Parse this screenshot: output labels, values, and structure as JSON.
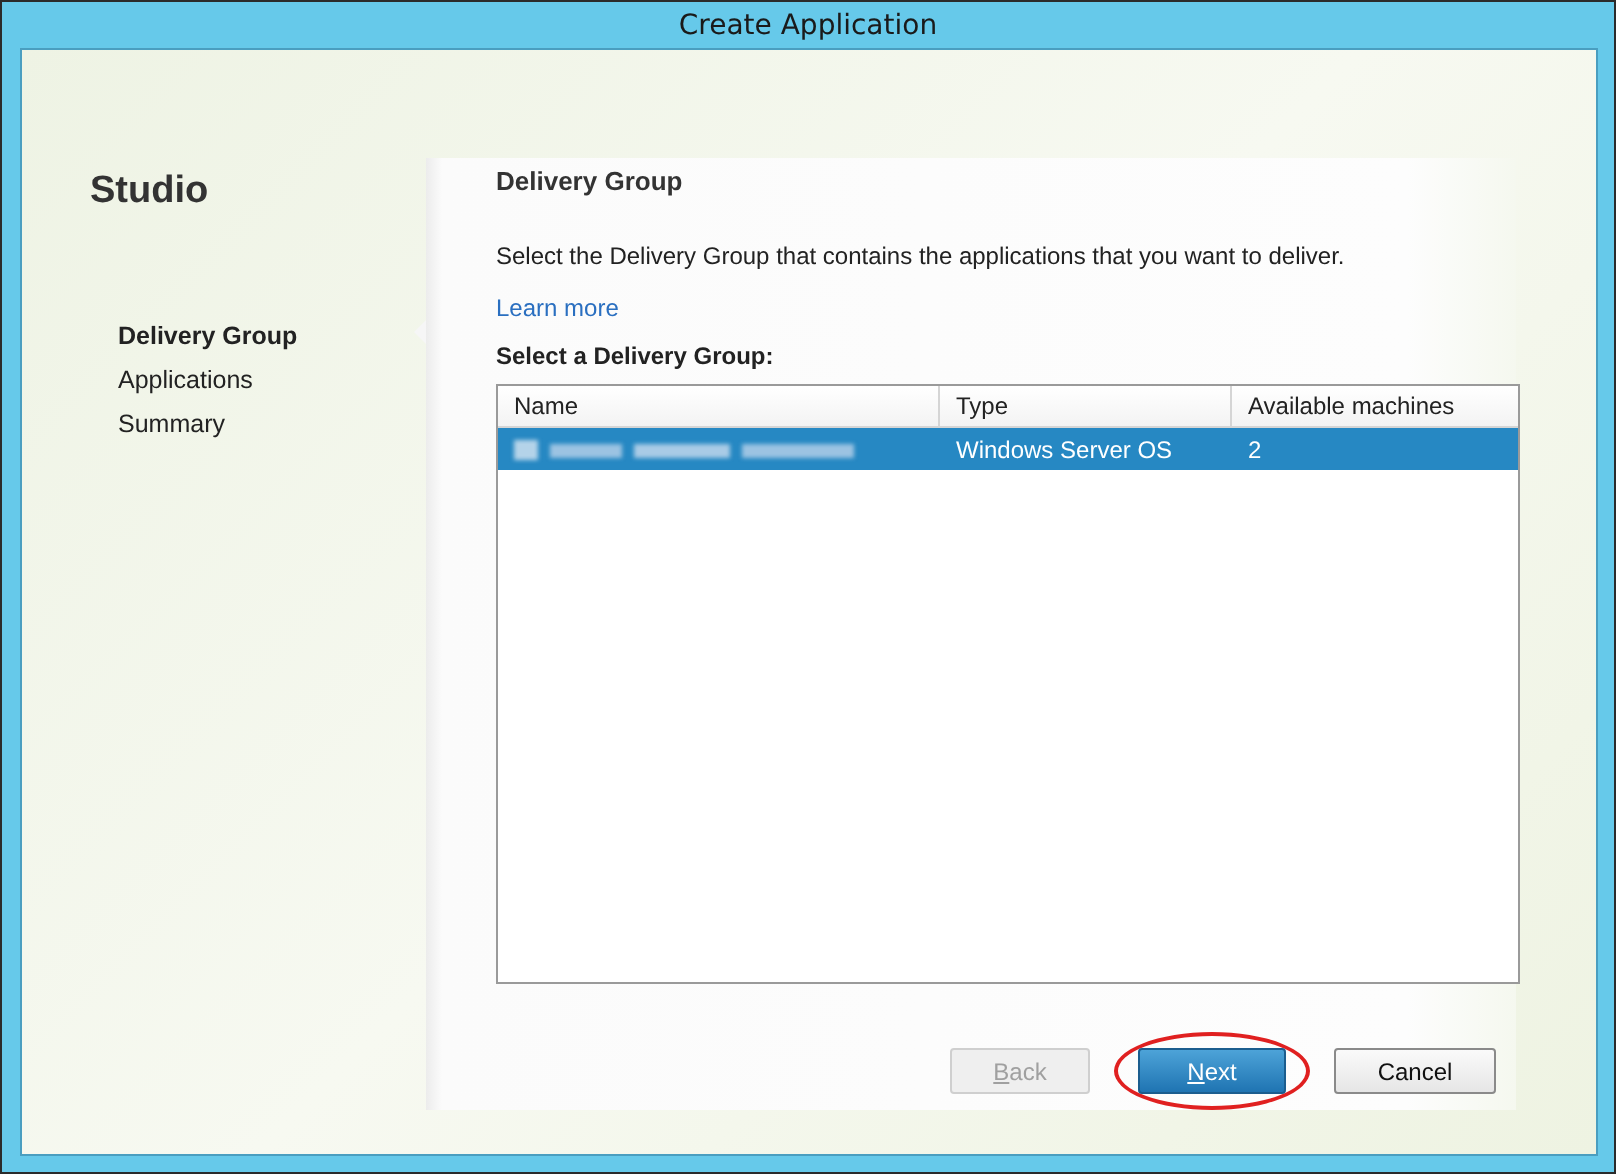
{
  "window": {
    "title": "Create Application"
  },
  "sidebar": {
    "title": "Studio",
    "items": [
      {
        "label": "Delivery Group",
        "selected": true
      },
      {
        "label": "Applications",
        "selected": false
      },
      {
        "label": "Summary",
        "selected": false
      }
    ]
  },
  "page": {
    "title": "Delivery Group",
    "description": "Select the Delivery Group that contains the applications that you want to deliver.",
    "link": "Learn more",
    "table_label": "Select a Delivery Group:"
  },
  "table": {
    "columns": [
      "Name",
      "Type",
      "Available machines"
    ],
    "rows": [
      {
        "name_blurred": true,
        "type": "Windows Server OS",
        "available": "2",
        "selected": true
      }
    ]
  },
  "buttons": [
    {
      "label": "Back",
      "underline_first": true,
      "kind": "secondary",
      "disabled": true,
      "circled": false
    },
    {
      "label": "Next",
      "underline_first": true,
      "kind": "primary",
      "disabled": false,
      "circled": true
    },
    {
      "label": "Cancel",
      "underline_first": false,
      "kind": "secondary",
      "disabled": false,
      "circled": false
    }
  ]
}
